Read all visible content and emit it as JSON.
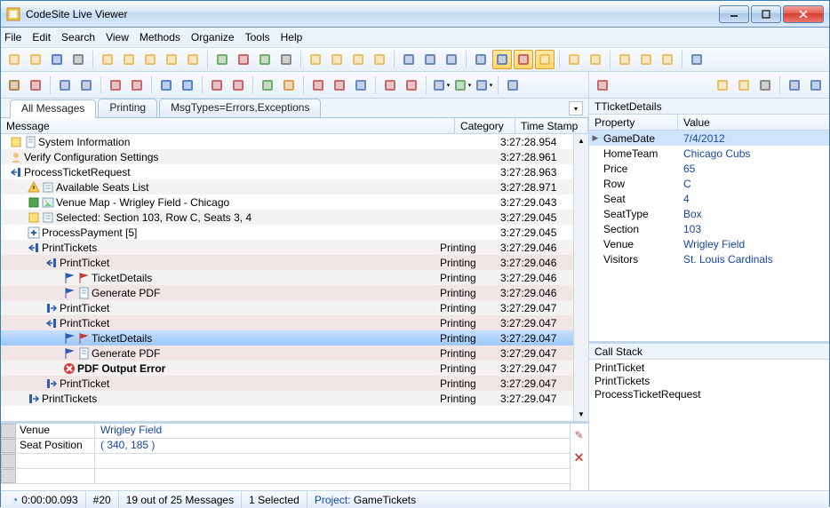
{
  "window": {
    "title": "CodeSite Live Viewer"
  },
  "menu": [
    "File",
    "Edit",
    "Search",
    "View",
    "Methods",
    "Organize",
    "Tools",
    "Help"
  ],
  "tabs": [
    {
      "label": "All Messages",
      "active": true
    },
    {
      "label": "Printing",
      "active": false
    },
    {
      "label": "MsgTypes=Errors,Exceptions",
      "active": false
    }
  ],
  "columns": {
    "message": "Message",
    "category": "Category",
    "timestamp": "Time Stamp"
  },
  "messages": [
    {
      "indent": 0,
      "icon": "note-yellow",
      "icon2": "sheet",
      "text": "System Information",
      "category": "",
      "ts": "3:27:28.954"
    },
    {
      "indent": 0,
      "icon": "user",
      "icon2": "",
      "text": "Verify Configuration Settings",
      "category": "",
      "ts": "3:27:28.961"
    },
    {
      "indent": 0,
      "icon": "enter-blue",
      "text": "ProcessTicketRequest",
      "category": "",
      "ts": "3:27:28.963"
    },
    {
      "indent": 1,
      "icon": "warn",
      "icon2": "list",
      "text": "Available Seats List",
      "category": "",
      "ts": "3:27:28.971"
    },
    {
      "indent": 1,
      "icon": "green",
      "icon2": "image",
      "text": "Venue Map - Wrigley Field - Chicago",
      "category": "",
      "ts": "3:27:29.043"
    },
    {
      "indent": 1,
      "icon": "note-yellow",
      "icon2": "list",
      "text": "Selected: Section 103, Row C, Seats 3, 4",
      "category": "",
      "ts": "3:27:29.045"
    },
    {
      "indent": 1,
      "icon": "plus-blue",
      "text": "ProcessPayment  [5]",
      "category": "",
      "ts": "3:27:29.045"
    },
    {
      "indent": 1,
      "icon": "enter-blue",
      "text": "PrintTickets",
      "category": "Printing",
      "ts": "3:27:29.046",
      "pink": true
    },
    {
      "indent": 2,
      "icon": "enter-blue",
      "text": "PrintTicket",
      "category": "Printing",
      "ts": "3:27:29.046",
      "pink": true,
      "alt": true
    },
    {
      "indent": 3,
      "icon": "flag-blue",
      "icon2": "flag-red2",
      "text": "TicketDetails",
      "category": "Printing",
      "ts": "3:27:29.046",
      "pink": true
    },
    {
      "indent": 3,
      "icon": "flag-blue",
      "icon2": "sheet",
      "text": "Generate PDF",
      "category": "Printing",
      "ts": "3:27:29.046",
      "pink": true,
      "alt": true
    },
    {
      "indent": 2,
      "icon": "exit-blue",
      "text": "PrintTicket",
      "category": "Printing",
      "ts": "3:27:29.047",
      "pink": true
    },
    {
      "indent": 2,
      "icon": "enter-blue",
      "text": "PrintTicket",
      "category": "Printing",
      "ts": "3:27:29.047",
      "pink": true,
      "alt": true
    },
    {
      "indent": 3,
      "icon": "flag-blue",
      "icon2": "flag-red2",
      "text": "TicketDetails",
      "category": "Printing",
      "ts": "3:27:29.047",
      "selected": true
    },
    {
      "indent": 3,
      "icon": "flag-blue",
      "icon2": "sheet",
      "text": "Generate PDF",
      "category": "Printing",
      "ts": "3:27:29.047",
      "pink": true,
      "alt": true
    },
    {
      "indent": 3,
      "icon": "error",
      "text": "PDF Output Error",
      "bold": true,
      "category": "Printing",
      "ts": "3:27:29.047",
      "pink": true
    },
    {
      "indent": 2,
      "icon": "exit-blue",
      "text": "PrintTicket",
      "category": "Printing",
      "ts": "3:27:29.047",
      "pink": true,
      "alt": true
    },
    {
      "indent": 1,
      "icon": "exit-blue",
      "text": "PrintTickets",
      "category": "Printing",
      "ts": "3:27:29.047",
      "pink": true
    }
  ],
  "bottom": {
    "rows": [
      {
        "key": "Venue",
        "value": "Wrigley Field"
      },
      {
        "key": "Seat Position",
        "value": "( 340, 185 )"
      }
    ]
  },
  "details": {
    "title": "TTicketDetails",
    "columns": {
      "property": "Property",
      "value": "Value"
    },
    "rows": [
      {
        "prop": "GameDate",
        "val": "7/4/2012",
        "selected": true
      },
      {
        "prop": "HomeTeam",
        "val": "Chicago Cubs"
      },
      {
        "prop": "Price",
        "val": "65"
      },
      {
        "prop": "Row",
        "val": "C"
      },
      {
        "prop": "Seat",
        "val": "4"
      },
      {
        "prop": "SeatType",
        "val": "Box"
      },
      {
        "prop": "Section",
        "val": "103"
      },
      {
        "prop": "Venue",
        "val": "Wrigley Field"
      },
      {
        "prop": "Visitors",
        "val": "St. Louis Cardinals"
      }
    ]
  },
  "callstack": {
    "title": "Call Stack",
    "lines": [
      "PrintTicket",
      "PrintTickets",
      "ProcessTicketRequest"
    ]
  },
  "status": {
    "time": "0:00:00.093",
    "count": "#20",
    "filter": "19 out of 25 Messages",
    "selected": "1 Selected",
    "project_label": "Project:",
    "project_value": "GameTickets"
  },
  "toolbar_icons": [
    {
      "n": "open-icon",
      "c": "#e8b64a"
    },
    {
      "n": "connect-icon",
      "c": "#e8b64a"
    },
    {
      "n": "save-icon",
      "c": "#3b6fbf"
    },
    {
      "n": "print-icon",
      "c": "#777"
    },
    {
      "sep": true
    },
    {
      "n": "bookmark-sun-icon",
      "c": "#e8b64a"
    },
    {
      "n": "bookmark-icon",
      "c": "#e8b64a"
    },
    {
      "n": "bookmark-right-icon",
      "c": "#e8b64a"
    },
    {
      "n": "bookmark-left-icon",
      "c": "#e8b64a"
    },
    {
      "n": "bookmark-target-icon",
      "c": "#e8b64a"
    },
    {
      "sep": true
    },
    {
      "n": "add-view-icon",
      "c": "#5a9e56"
    },
    {
      "n": "remove-view-icon",
      "c": "#c05050"
    },
    {
      "n": "show-view-icon",
      "c": "#5a9e56"
    },
    {
      "n": "arrange-view-icon",
      "c": "#777"
    },
    {
      "sep": true
    },
    {
      "n": "group-toolbar1-icon",
      "c": "#e8b64a"
    },
    {
      "n": "group-toolbar2-icon",
      "c": "#e8b64a"
    },
    {
      "n": "group-toolbar3-icon",
      "c": "#e8b64a"
    },
    {
      "n": "group-toolbar4-icon",
      "c": "#e8b64a"
    },
    {
      "sep": true
    },
    {
      "n": "columns-icon",
      "c": "#5277b3"
    },
    {
      "n": "list-icon",
      "c": "#5277b3"
    },
    {
      "n": "grid-icon",
      "c": "#5277b3"
    },
    {
      "sep": true
    },
    {
      "n": "panel-icon",
      "c": "#5277b3"
    },
    {
      "n": "find-icon",
      "c": "#5277b3",
      "sel": true
    },
    {
      "n": "filter-icon",
      "c": "#c05050",
      "sel": true
    },
    {
      "n": "link-icon",
      "c": "#e8b64a",
      "sel": true
    },
    {
      "sep": true
    },
    {
      "n": "output1-icon",
      "c": "#e8b64a"
    },
    {
      "n": "output2-icon",
      "c": "#e8b64a"
    },
    {
      "sep": true
    },
    {
      "n": "pref1-icon",
      "c": "#e8b64a"
    },
    {
      "n": "pref2-icon",
      "c": "#e8b64a"
    },
    {
      "n": "pref3-icon",
      "c": "#e8b64a"
    },
    {
      "sep": true
    },
    {
      "n": "help-icon",
      "c": "#5277b3"
    }
  ],
  "toolbar2_icons": [
    {
      "n": "circle-icon",
      "c": "#9d7535"
    },
    {
      "n": "flag-red-icon",
      "c": "#c05050"
    },
    {
      "sep": true
    },
    {
      "n": "doc1-icon",
      "c": "#5277b3"
    },
    {
      "n": "doc2-icon",
      "c": "#5277b3"
    },
    {
      "sep": true
    },
    {
      "n": "paint-icon",
      "c": "#c05050"
    },
    {
      "n": "delete-icon",
      "c": "#c05050"
    },
    {
      "sep": true
    },
    {
      "n": "nav-first-icon",
      "c": "#3b6fbf"
    },
    {
      "n": "nav-prev-icon",
      "c": "#3b6fbf"
    },
    {
      "sep": true
    },
    {
      "n": "collapse-icon",
      "c": "#c05050"
    },
    {
      "n": "expand-icon",
      "c": "#c05050"
    },
    {
      "sep": true
    },
    {
      "n": "dot-green-icon",
      "c": "#5a9e56"
    },
    {
      "n": "dot-orange-icon",
      "c": "#d89030"
    },
    {
      "sep": true
    },
    {
      "n": "tree1-icon",
      "c": "#c05050"
    },
    {
      "n": "tree2-icon",
      "c": "#c05050"
    },
    {
      "n": "tree3-icon",
      "c": "#5277b3"
    },
    {
      "sep": true
    },
    {
      "n": "paint2-icon",
      "c": "#c05050"
    },
    {
      "n": "paint3-icon",
      "c": "#c05050"
    },
    {
      "sep": true
    },
    {
      "n": "dd1-icon",
      "c": "#5277b3",
      "dd": true
    },
    {
      "n": "dd2-icon",
      "c": "#5a9e56",
      "dd": true
    },
    {
      "n": "dd3-icon",
      "c": "#5277b3",
      "dd": true
    },
    {
      "sep": true
    },
    {
      "n": "diamond-icon",
      "c": "#5277b3"
    }
  ],
  "right_toolbar_icons": [
    {
      "n": "obj-icon",
      "c": "#c05050"
    },
    {
      "spacer": true
    },
    {
      "n": "copy1-icon",
      "c": "#e8b64a"
    },
    {
      "n": "copy2-icon",
      "c": "#e8b64a"
    },
    {
      "n": "rprint-icon",
      "c": "#777"
    },
    {
      "sep": true
    },
    {
      "n": "panel1-icon",
      "c": "#5277b3"
    },
    {
      "n": "panel2-icon",
      "c": "#5277b3"
    }
  ]
}
